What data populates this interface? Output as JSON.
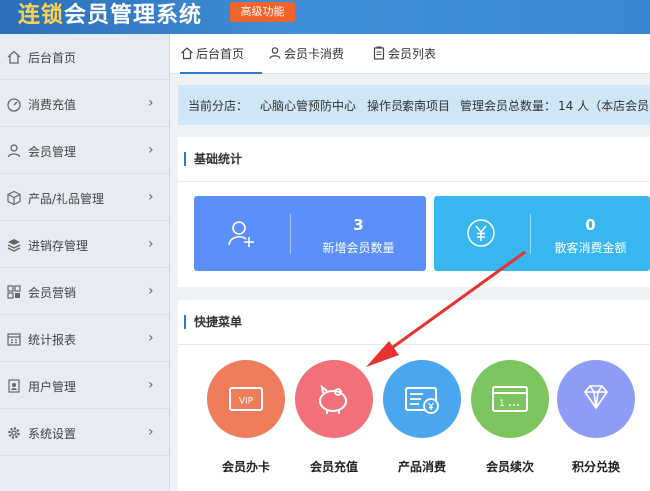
{
  "header": {
    "title_highlight": "连锁",
    "title_rest": "会员管理系统",
    "pro_badge": "高级功能"
  },
  "sidebar": {
    "items": [
      {
        "label": "后台首页",
        "icon": "home-icon"
      },
      {
        "label": "消费充值",
        "icon": "gauge-icon"
      },
      {
        "label": "会员管理",
        "icon": "user-icon"
      },
      {
        "label": "产品/礼品管理",
        "icon": "box-icon"
      },
      {
        "label": "进销存管理",
        "icon": "layers-icon"
      },
      {
        "label": "会员营销",
        "icon": "grid-icon"
      },
      {
        "label": "统计报表",
        "icon": "calendar-icon"
      },
      {
        "label": "用户管理",
        "icon": "user-file-icon"
      },
      {
        "label": "系统设置",
        "icon": "gear-icon"
      }
    ]
  },
  "tabs": [
    {
      "label": "后台首页",
      "icon": "home-icon"
    },
    {
      "label": "会员卡消费",
      "icon": "user-icon"
    },
    {
      "label": "会员列表",
      "icon": "clipboard-icon"
    }
  ],
  "infobar": {
    "branch_label": "当前分店：",
    "branch_value": "心脑心管预防中心",
    "operator_label": "操作员：",
    "operator_value": "索南项目",
    "members_label": "管理会员总数量：",
    "members_value": "14 人（本店会员"
  },
  "stats": {
    "title": "基础统计",
    "cards": [
      {
        "value": "3",
        "label": "新增会员数量",
        "color": "#5b8ff9",
        "icon": "user-add-icon"
      },
      {
        "value": "0",
        "label": "散客消费金额",
        "color": "#38b6f0",
        "icon": "yen-icon"
      }
    ]
  },
  "quick": {
    "title": "快捷菜单",
    "items": [
      {
        "label": "会员办卡",
        "color": "#ef7c5a",
        "icon": "vip-card-icon"
      },
      {
        "label": "会员充值",
        "color": "#f2707a",
        "icon": "piggy-bank-icon"
      },
      {
        "label": "产品消费",
        "color": "#4aa6ee",
        "icon": "yen-document-icon"
      },
      {
        "label": "会员续次",
        "color": "#7cc45e",
        "icon": "card-icon"
      },
      {
        "label": "积分兑换",
        "color": "#8f9cf6",
        "icon": "diamond-icon"
      }
    ]
  },
  "annotation": {
    "color": "#e8322e"
  }
}
